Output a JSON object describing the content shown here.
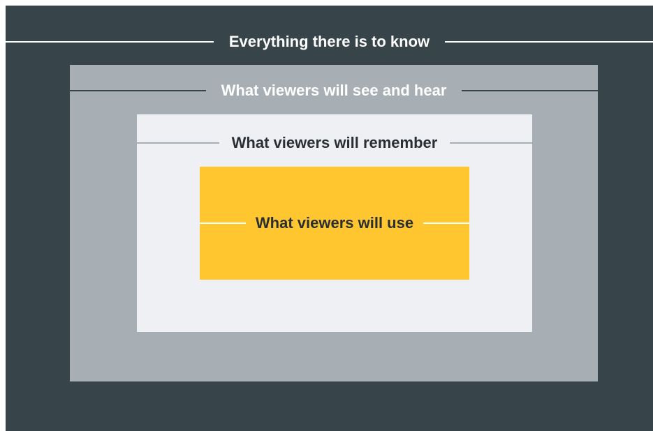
{
  "colors": {
    "outer_bg": "#37444a",
    "mid_bg": "#a7afb5",
    "inner_bg": "#eef0f3",
    "core_bg": "#ffc630",
    "outer_text": "#ffffff",
    "mid_text": "#ffffff",
    "inner_text": "#2a2f33",
    "core_text": "#2a2f33",
    "outer_line": "#ffffff",
    "mid_line": "#37444a",
    "inner_line": "#a7afb5",
    "core_line": "#ffffff"
  },
  "levels": [
    {
      "label": "Everything there is to know"
    },
    {
      "label": "What viewers will see and hear"
    },
    {
      "label": "What viewers will remember"
    },
    {
      "label": "What viewers will use"
    }
  ]
}
